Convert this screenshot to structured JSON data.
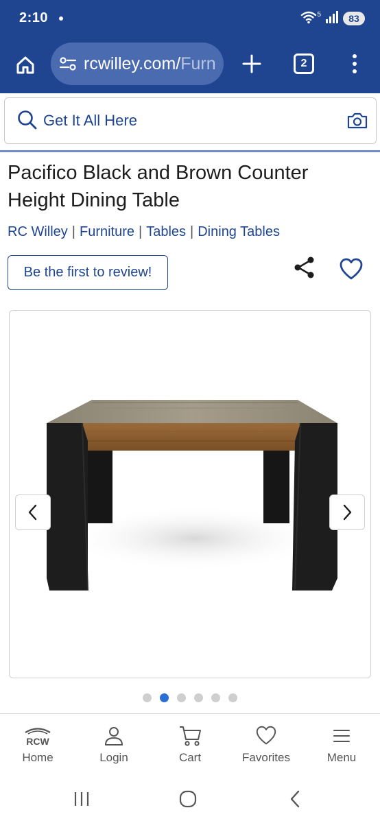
{
  "status_bar": {
    "time": "2:10",
    "battery": "83",
    "network": "5"
  },
  "browser": {
    "url_visible": "rcwilley.com/",
    "url_faded": "Furn",
    "tab_count": "2"
  },
  "search": {
    "placeholder": "Get It All Here"
  },
  "product": {
    "title": "Pacifico Black and Brown Counter Height Dining Table",
    "breadcrumb": [
      "RC Willey",
      "Furniture",
      "Tables",
      "Dining Tables"
    ],
    "review_label": "Be the first to review!"
  },
  "carousel": {
    "total": 6,
    "active_index": 1
  },
  "bottom_nav": {
    "items": [
      {
        "label": "Home",
        "icon": "rcw-logo-icon"
      },
      {
        "label": "Login",
        "icon": "user-icon"
      },
      {
        "label": "Cart",
        "icon": "cart-icon"
      },
      {
        "label": "Favorites",
        "icon": "heart-icon"
      },
      {
        "label": "Menu",
        "icon": "hamburger-icon"
      }
    ],
    "logo_text": "RCW"
  },
  "colors": {
    "brand": "#1f4591",
    "accent": "#2b6fd6"
  }
}
